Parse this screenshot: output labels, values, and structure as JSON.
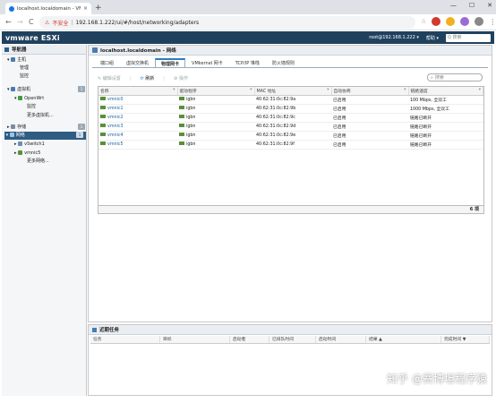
{
  "browser": {
    "tab_title": "localhost.localdomain - VMware",
    "tab_close": "×",
    "new_tab": "+",
    "window_controls": [
      "—",
      "☐",
      "✕"
    ],
    "nav": {
      "back": "←",
      "forward": "→",
      "reload": "C"
    },
    "security": "不安全",
    "url": "192.168.1.222/ui/#/host/networking/adapters",
    "menu": "⋮"
  },
  "esxi_header": {
    "logo": "vmware ESXi",
    "user": "root@192.168.1.222 ▾",
    "help": "帮助 ▾",
    "search_placeholder": "Q 搜索"
  },
  "navigator": {
    "title": "导航器",
    "items": [
      {
        "label": "主机",
        "badge": ""
      },
      {
        "label": "管理",
        "badge": ""
      },
      {
        "label": "监控",
        "badge": ""
      },
      {
        "label": "虚拟机",
        "badge": "1"
      },
      {
        "label": "OpenWrt",
        "badge": ""
      },
      {
        "label": "监控",
        "badge": ""
      },
      {
        "label": "更多虚拟机...",
        "badge": ""
      },
      {
        "label": "存储",
        "badge": "1"
      },
      {
        "label": "网络",
        "badge": "1"
      },
      {
        "label": "vSwitch1",
        "badge": ""
      },
      {
        "label": "vmnic5",
        "badge": ""
      },
      {
        "label": "更多网络...",
        "badge": ""
      }
    ]
  },
  "main": {
    "title": "localhost.localdomain - 网络",
    "tabs": [
      "端口组",
      "虚拟交换机",
      "物理网卡",
      "VMkernel 网卡",
      "TCP/IP 堆栈",
      "防火墙规则"
    ],
    "active_tab": 2,
    "toolbar": {
      "edit": "编辑设置",
      "refresh": "刷新",
      "actions": "操作"
    },
    "search_placeholder": "搜索",
    "columns": [
      "名称",
      "驱动程序",
      "MAC 地址",
      "自动协商",
      "链路速度"
    ],
    "rows": [
      {
        "name": "vmnic0",
        "driver": "igbn",
        "mac": "40:62:31:0c:82:9a",
        "auto": "已启用",
        "speed": "100 Mbps, 全双工"
      },
      {
        "name": "vmnic1",
        "driver": "igbn",
        "mac": "40:62:31:0c:82:9b",
        "auto": "已启用",
        "speed": "1000 Mbps, 全双工"
      },
      {
        "name": "vmnic2",
        "driver": "igbn",
        "mac": "40:62:31:0c:82:9c",
        "auto": "已启用",
        "speed": "链路已断开"
      },
      {
        "name": "vmnic3",
        "driver": "igbn",
        "mac": "40:62:31:0c:82:9d",
        "auto": "已启用",
        "speed": "链路已断开"
      },
      {
        "name": "vmnic4",
        "driver": "igbn",
        "mac": "40:62:31:0c:82:9e",
        "auto": "已启用",
        "speed": "链路已断开"
      },
      {
        "name": "vmnic5",
        "driver": "igbn",
        "mac": "40:62:31:0c:82:9f",
        "auto": "已启用",
        "speed": "链路已断开"
      }
    ],
    "item_count": "6 项"
  },
  "tasks": {
    "title": "近期任务",
    "columns": [
      "任务",
      "目标",
      "启动者",
      "已排队时间",
      "启动时间",
      "结果 ▲",
      "完成时间 ▼"
    ]
  },
  "watermark": "知乎 @赛博坦程序猿",
  "colors": {
    "header": "#20415e",
    "selected": "#2f5c83",
    "nic": "#5a8f3a"
  }
}
